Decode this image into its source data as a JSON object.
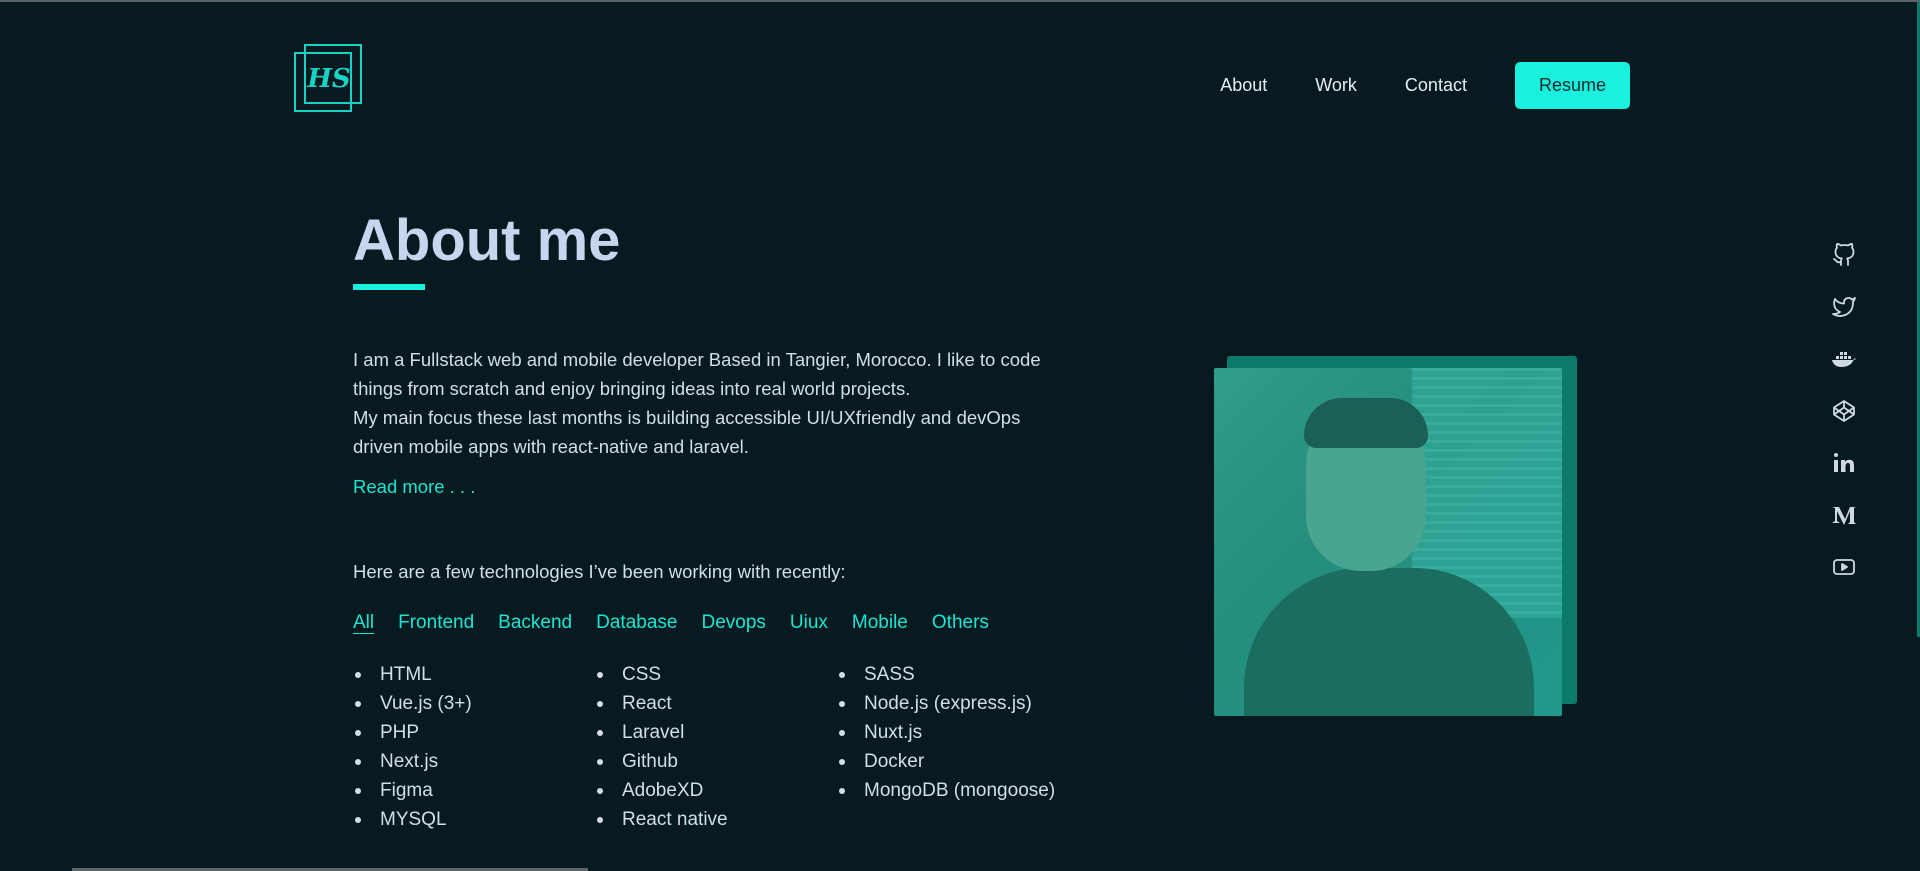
{
  "logo": {
    "monogram": "HS"
  },
  "nav": {
    "items": [
      "About",
      "Work",
      "Contact"
    ],
    "resume_label": "Resume"
  },
  "about": {
    "title": "About me",
    "paragraph1": "I am a Fullstack web and mobile developer Based in Tangier, Morocco. I like to code things from scratch and enjoy bringing ideas into real world projects.",
    "paragraph2": "My main focus these last months is building accessible UI/UXfriendly and devOps driven mobile apps with react-native and laravel.",
    "read_more": "Read more . . ."
  },
  "tech": {
    "intro": "Here are a few technologies I’ve been working with recently:",
    "tabs": [
      "All",
      "Frontend",
      "Backend",
      "Database",
      "Devops",
      "Uiux",
      "Mobile",
      "Others"
    ],
    "active_tab": "All",
    "columns": [
      [
        "HTML",
        "Vue.js (3+)",
        "PHP",
        "Next.js",
        "Figma",
        "MYSQL"
      ],
      [
        "CSS",
        "React",
        "Laravel",
        "Github",
        "AdobeXD",
        "React native"
      ],
      [
        "SASS",
        "Node.js (express.js)",
        "Nuxt.js",
        "Docker",
        "MongoDB (mongoose)"
      ]
    ]
  },
  "social_icons": [
    "github-icon",
    "twitter-icon",
    "docker-icon",
    "codepen-icon",
    "linkedin-icon",
    "medium-icon",
    "youtube-icon"
  ],
  "colors": {
    "background": "#071a20",
    "accent": "#19f0dd",
    "heading": "#c9d5ef",
    "text": "#d4dde8"
  }
}
